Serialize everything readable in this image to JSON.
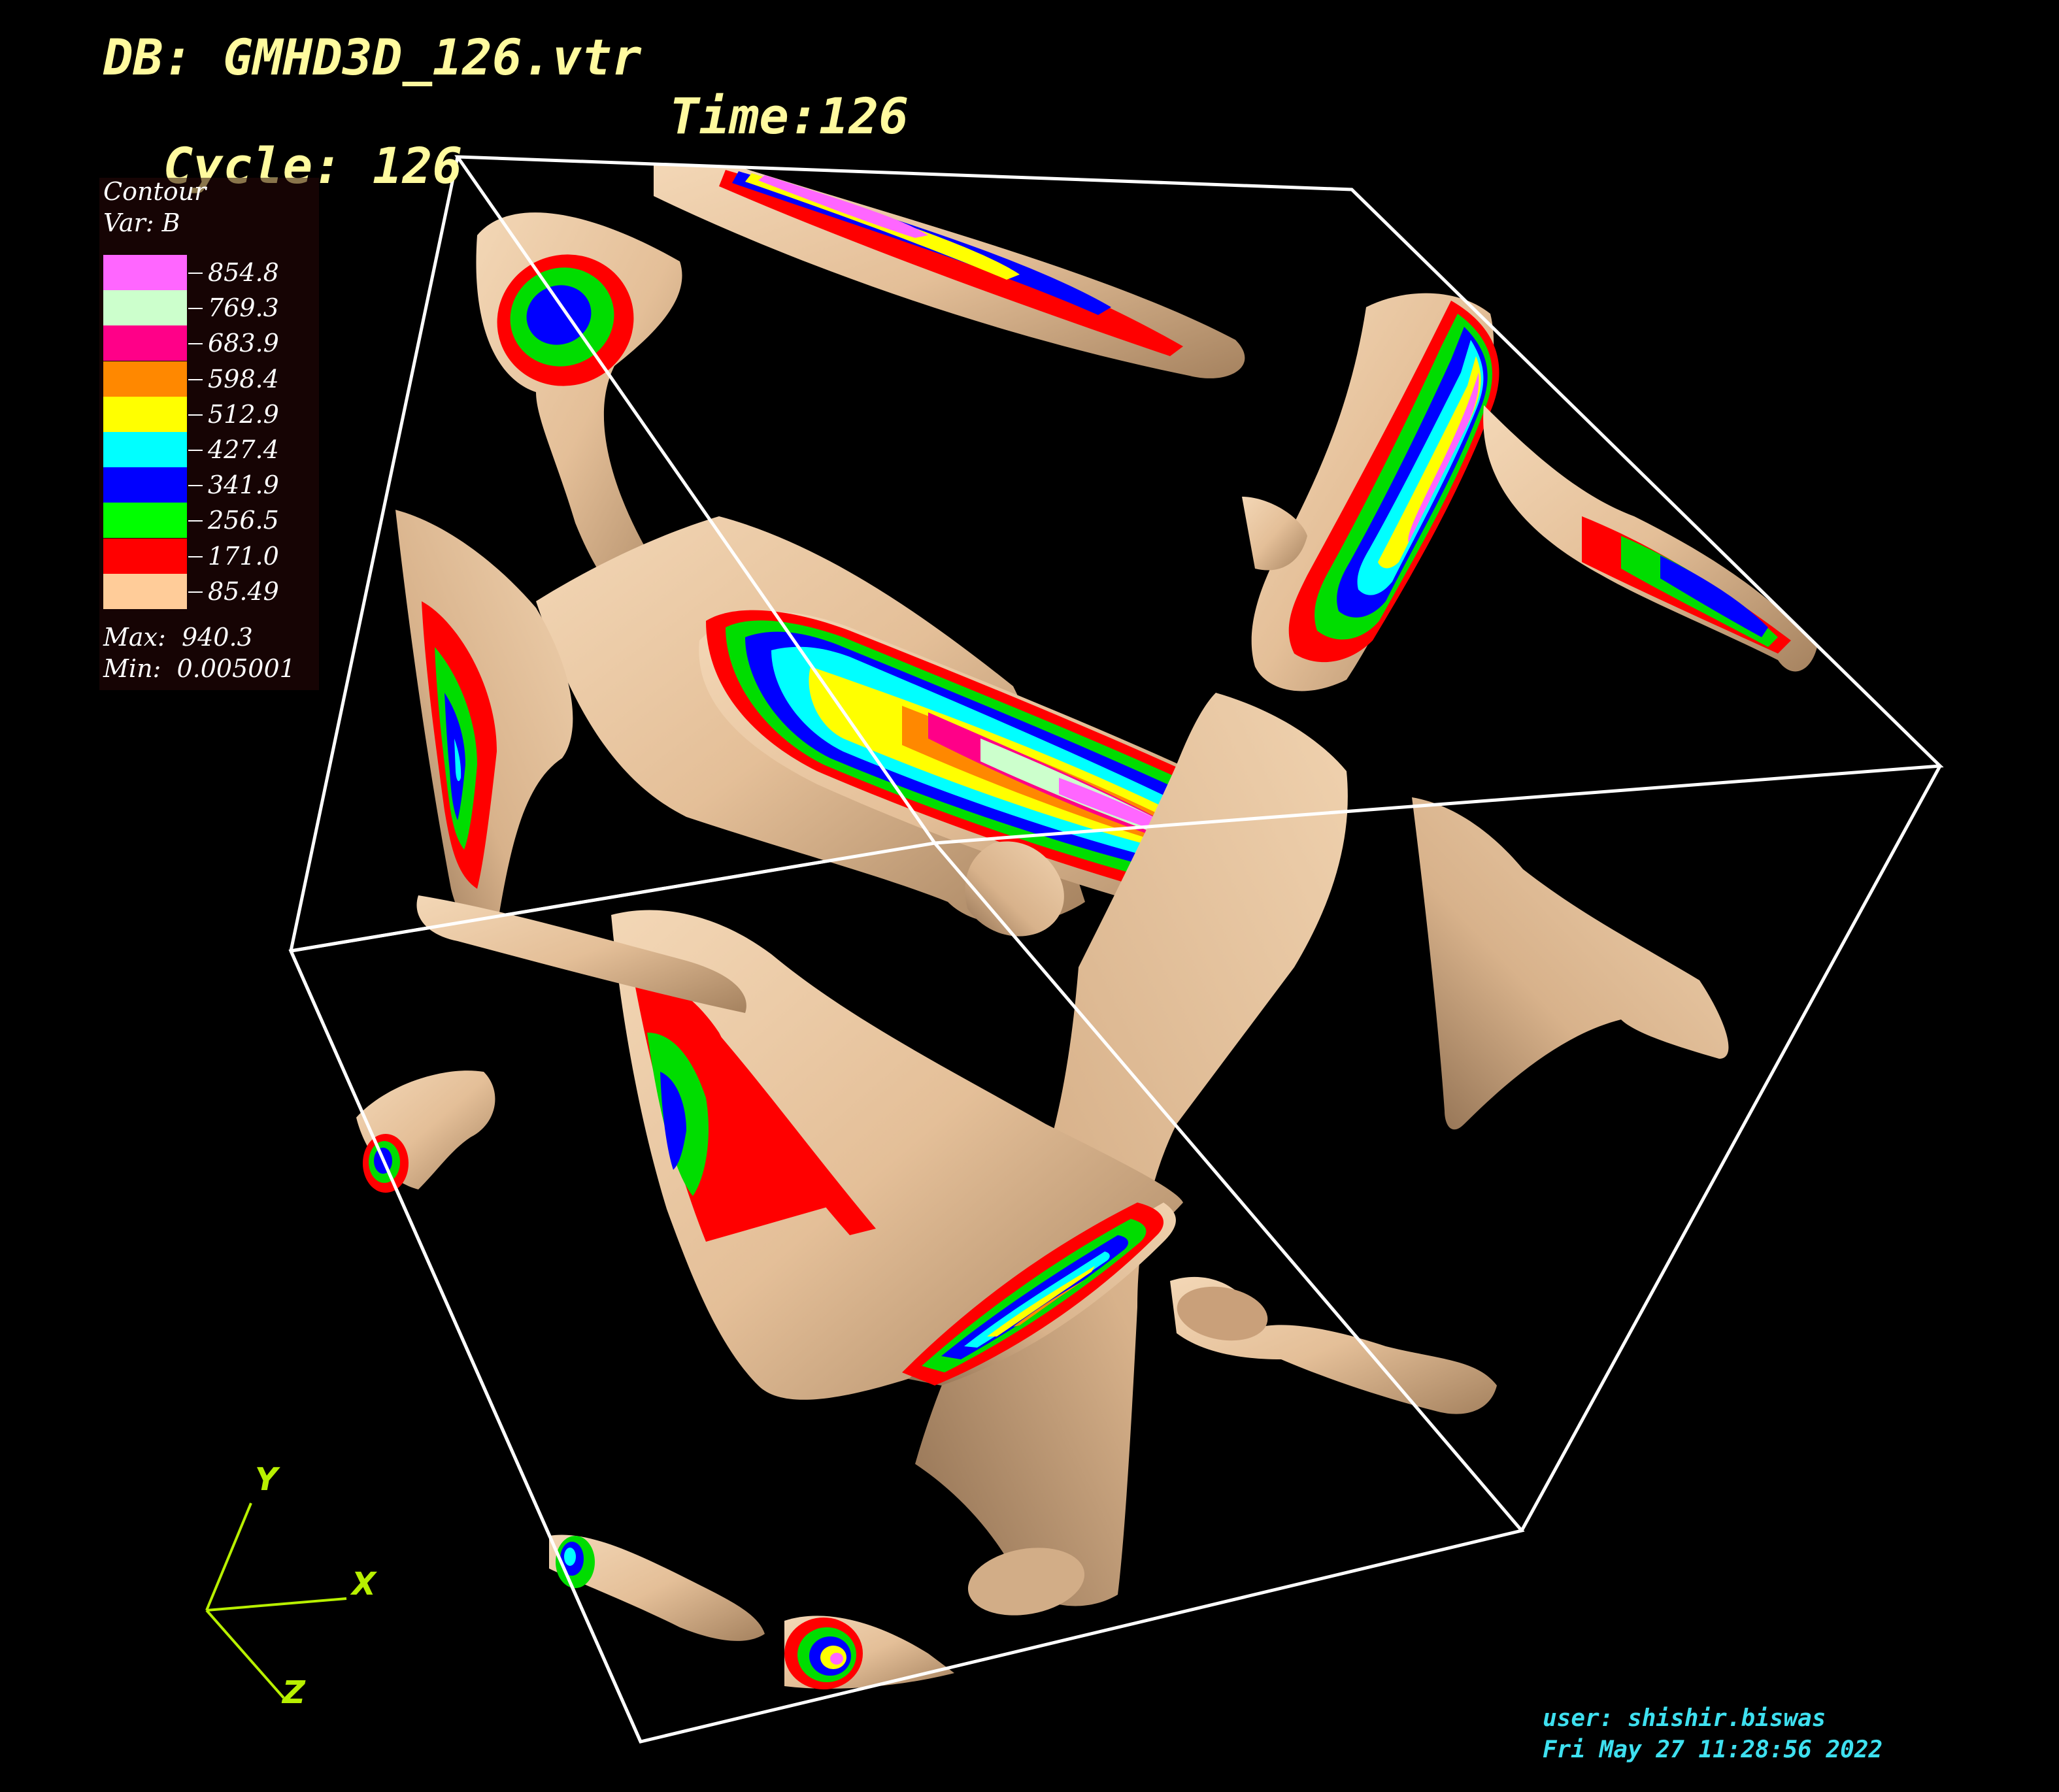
{
  "header": {
    "db": "DB: GMHD3D_126.vtr",
    "cycle": "Cycle: 126",
    "time": "Time:126"
  },
  "legend": {
    "title": "Contour",
    "variable": "Var: B",
    "levels": [
      {
        "value": "854.8",
        "color": "#ff66ff"
      },
      {
        "value": "769.3",
        "color": "#ccffcc"
      },
      {
        "value": "683.9",
        "color": "#ff0088"
      },
      {
        "value": "598.4",
        "color": "#ff8800"
      },
      {
        "value": "512.9",
        "color": "#ffff00"
      },
      {
        "value": "427.4",
        "color": "#00ffff"
      },
      {
        "value": "341.9",
        "color": "#0000ff"
      },
      {
        "value": "256.5",
        "color": "#00ff00"
      },
      {
        "value": "171.0",
        "color": "#ff0000"
      },
      {
        "value": "85.49",
        "color": "#ffcc99"
      }
    ],
    "max": "Max:  940.3",
    "min": "Min:  0.005001"
  },
  "footer": {
    "user": "user: shishir.biswas",
    "date": "Fri May 27 11:28:56 2022"
  },
  "axes": {
    "x": "X",
    "y": "Y",
    "z": "Z",
    "color": "#b8f000"
  },
  "colors": {
    "surface": "#e8c4a0",
    "box": "#ffffff",
    "background": "#000000"
  }
}
